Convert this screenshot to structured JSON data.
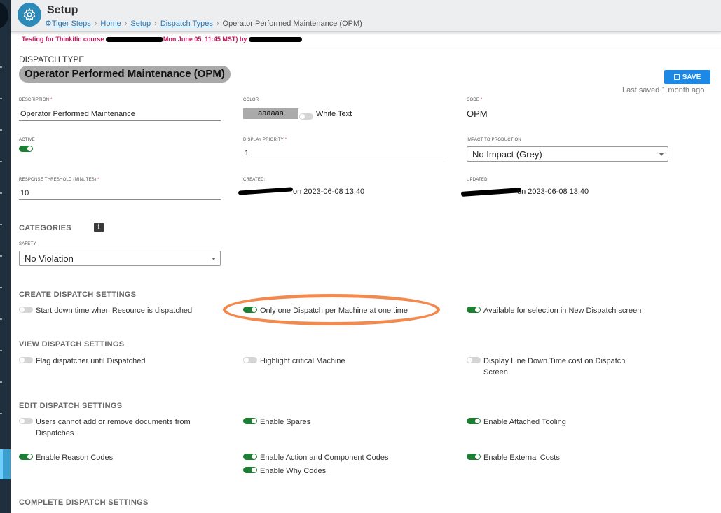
{
  "header": {
    "title": "Setup",
    "breadcrumbs": [
      {
        "label": "Tiger Steps"
      },
      {
        "label": "Home"
      },
      {
        "label": "Setup"
      },
      {
        "label": "Dispatch Types"
      },
      {
        "label": "Operator Performed Maintenance (OPM)"
      }
    ]
  },
  "notice": {
    "prefix": "Testing for Thinkific course",
    "date": "Mon June 05, 11:45 MST) by"
  },
  "dispatch_type": {
    "section_label": "DISPATCH TYPE",
    "name": "Operator Performed Maintenance (OPM)",
    "save_label": "SAVE",
    "last_saved": "Last saved 1 month ago"
  },
  "fields": {
    "description": {
      "label": "DESCRIPTION",
      "value": "Operator Performed Maintenance"
    },
    "color": {
      "label": "COLOR",
      "value": "aaaaaa",
      "white_text_label": "White Text"
    },
    "code": {
      "label": "CODE",
      "value": "OPM"
    },
    "active": {
      "label": "ACTIVE",
      "on": true
    },
    "display_priority": {
      "label": "DISPLAY PRIORITY",
      "value": "1"
    },
    "impact": {
      "label": "IMPACT TO PRODUCTION",
      "value": "No Impact (Grey)"
    },
    "response_threshold": {
      "label": "RESPONSE THRESHOLD (MINUTES)",
      "value": "10"
    },
    "created": {
      "label": "CREATED:",
      "value": "on 2023-06-08 13:40"
    },
    "updated": {
      "label": "UPDATED",
      "value": "on 2023-06-08 13:40"
    }
  },
  "categories": {
    "title": "CATEGORIES",
    "info_glyph": "i",
    "safety": {
      "label": "SAFETY",
      "value": "No Violation"
    }
  },
  "create_settings": {
    "title": "CREATE DISPATCH SETTINGS",
    "options": [
      {
        "label": "Start down time when Resource is dispatched",
        "on": false
      },
      {
        "label": "Only one Dispatch per Machine at one time",
        "on": true
      },
      {
        "label": "Available for selection in New Dispatch screen",
        "on": true
      }
    ]
  },
  "view_settings": {
    "title": "VIEW DISPATCH SETTINGS",
    "options": [
      {
        "label": "Flag dispatcher until Dispatched",
        "on": false
      },
      {
        "label": "Highlight critical Machine",
        "on": false
      },
      {
        "label": "Display Line Down Time cost on Dispatch Screen",
        "on": false
      }
    ]
  },
  "edit_settings": {
    "title": "EDIT DISPATCH SETTINGS",
    "options": [
      {
        "label": "Users cannot add or remove documents from Dispatches",
        "on": false
      },
      {
        "label": "Enable Spares",
        "on": true
      },
      {
        "label": "Enable Attached Tooling",
        "on": true
      },
      {
        "label": "Enable Reason Codes",
        "on": true
      },
      {
        "label": "Enable Action and Component Codes",
        "on": true
      },
      {
        "label": "Enable External Costs",
        "on": true
      },
      {
        "label": "Enable Why Codes",
        "on": true
      }
    ]
  },
  "complete_settings": {
    "title": "COMPLETE DISPATCH SETTINGS"
  },
  "colors": {
    "accent": "#1e88e5",
    "toggle_on": "#1e7e34",
    "annotation": "#f28a50",
    "badge_bg": "#a9a9a9"
  }
}
